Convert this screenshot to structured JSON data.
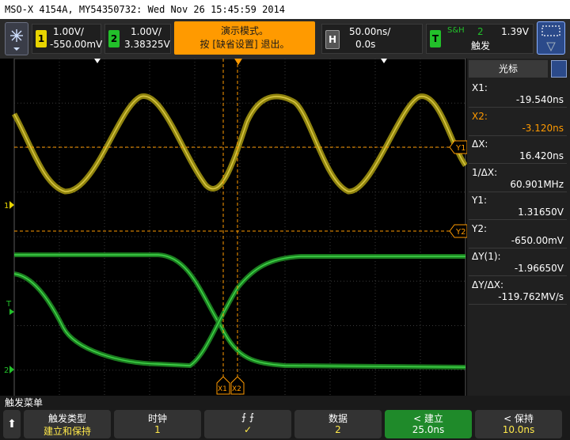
{
  "title": "MSO-X 4154A, MY54350732: Wed Nov 26 15:45:59 2014",
  "colors": {
    "ch1": "#e8d400",
    "ch2": "#22c02a",
    "cursor": "#ff9a00",
    "trigger": "#22c02a"
  },
  "channels": [
    {
      "num": "1",
      "scale": "1.00V/",
      "offset": "-550.00mV"
    },
    {
      "num": "2",
      "scale": "1.00V/",
      "offset": "3.38325V"
    }
  ],
  "banner": {
    "line1": "演示模式。",
    "line2": "按 [缺省设置] 退出。"
  },
  "horizontal": {
    "label": "H",
    "scale": "50.00ns/",
    "delay": "0.0s"
  },
  "trigger": {
    "label": "T",
    "mode": "S&H",
    "source": "2",
    "level": "1.39V",
    "name": "触发"
  },
  "panel": {
    "title": "光标",
    "rows": [
      {
        "label": "X1:",
        "value": "-19.540ns",
        "highlight": false
      },
      {
        "label": "X2:",
        "value": "-3.120ns",
        "highlight": true
      },
      {
        "label": "ΔX:",
        "value": "16.420ns",
        "highlight": false
      },
      {
        "label": "1/ΔX:",
        "value": "60.901MHz",
        "highlight": false
      },
      {
        "label": "Y1:",
        "value": "1.31650V",
        "highlight": false
      },
      {
        "label": "Y2:",
        "value": "-650.00mV",
        "highlight": false
      },
      {
        "label": "ΔY(1):",
        "value": "-1.96650V",
        "highlight": false
      },
      {
        "label": "ΔY/ΔX:",
        "value": "-119.762MV/s",
        "highlight": false
      }
    ]
  },
  "markers": {
    "x1": "X1",
    "x2": "X2",
    "y1": "Y1",
    "y2": "Y2",
    "ch1": "1",
    "ch2": "2",
    "trig": "T"
  },
  "menu": {
    "title": "触发菜单",
    "keys": [
      {
        "l1": "触发类型",
        "l2": "建立和保持",
        "active": false
      },
      {
        "l1": "时钟",
        "l2": "1",
        "active": false
      },
      {
        "l1": "⨍       ⨍",
        "l2": "✓",
        "active": false
      },
      {
        "l1": "数据",
        "l2": "2",
        "active": false
      },
      {
        "l1": "< 建立",
        "l2": "25.0ns",
        "active": true
      },
      {
        "l1": "< 保持",
        "l2": "10.0ns",
        "active": false
      }
    ]
  }
}
